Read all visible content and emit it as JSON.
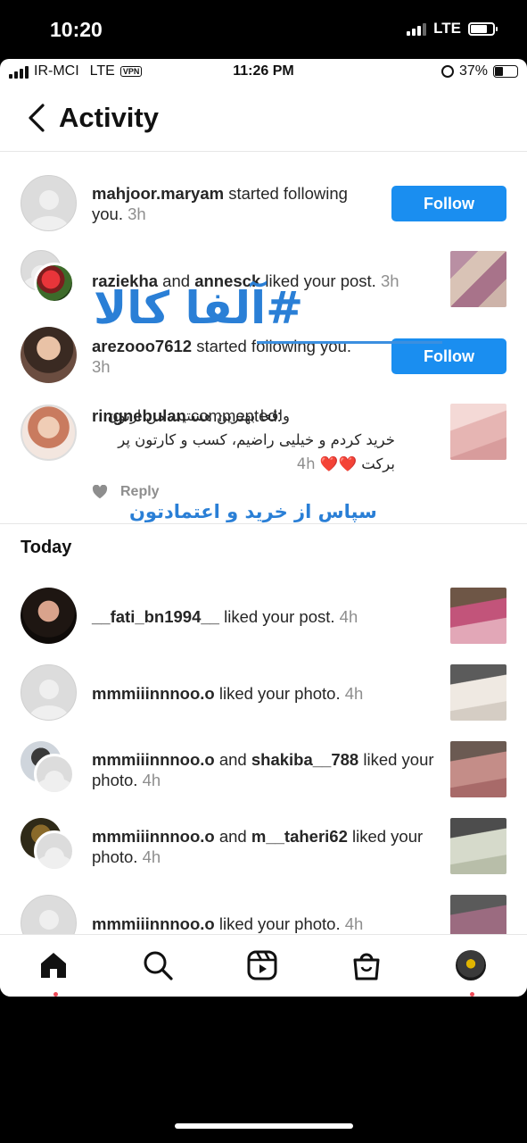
{
  "outer_status": {
    "time": "10:20",
    "network": "LTE",
    "battery_level": 0.75
  },
  "inner_status": {
    "carrier": "IR-MCI",
    "network": "LTE",
    "vpn": "VPN",
    "time": "11:26 PM",
    "battery": "37%",
    "battery_level": 0.37
  },
  "header": {
    "title": "Activity",
    "back_icon": "chevron-left-icon"
  },
  "notifications": [
    {
      "user": "mahjoor.maryam",
      "text": " started following you.",
      "time": " 3h",
      "action": "Follow"
    },
    {
      "user": "raziekha",
      "and": " and ",
      "user2": "annesck",
      "text": " liked your post.",
      "time": " 3h"
    },
    {
      "user": "arezooo7612",
      "text": " started following you.",
      "time": " 3h",
      "action": "Follow"
    },
    {
      "user": "ringnebulan",
      "text": " commented: ",
      "comment": "واقعا بهترین هستید، من ازتون خرید کردم و خیلیی راضیم، کسب و کارتون پر برکت ❤️❤️",
      "time": "4h"
    }
  ],
  "reply": {
    "label": "Reply",
    "heart_icon": "heart-icon"
  },
  "today": {
    "title": "Today",
    "items": [
      {
        "user": "__fati_bn1994__",
        "text": " liked your post.",
        "time": " 4h"
      },
      {
        "user": "mmmiiinnnoo.o",
        "text": " liked your photo.",
        "time": " 4h"
      },
      {
        "user": "mmmiiinnnoo.o",
        "and": " and ",
        "user2": "shakiba__788",
        "text": " liked your photo.",
        "time": " 4h"
      },
      {
        "user": "mmmiiinnnoo.o",
        "and": " and ",
        "user2": "m__taheri62",
        "text": " liked your photo.",
        "time": " 4h"
      },
      {
        "user": "mmmiiinnnoo.o",
        "text": " liked your photo.",
        "time": " 4h"
      }
    ]
  },
  "overlay": {
    "watermark": "#آلفا کالا",
    "caption": "سپاس از خرید و اعتمادتون"
  },
  "nav": [
    "home-icon",
    "search-icon",
    "reels-icon",
    "shop-icon",
    "profile-avatar"
  ],
  "colors": {
    "accent": "#1a8ef0",
    "watermark": "#2a7fd6",
    "notification_dot": "#ed4956"
  }
}
